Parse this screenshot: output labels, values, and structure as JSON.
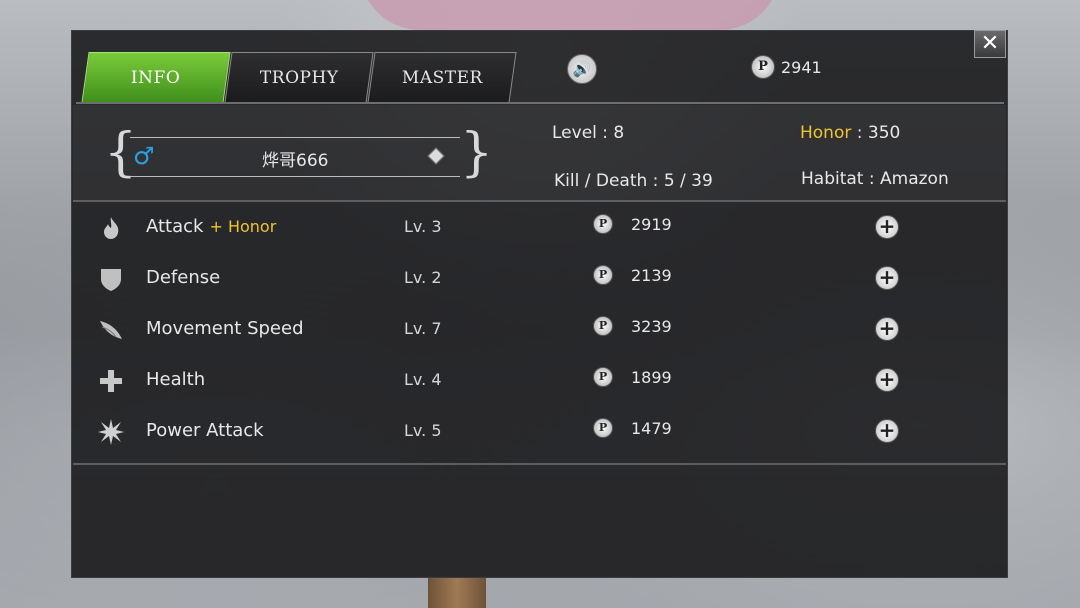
{
  "tabs": [
    {
      "label": "INFO",
      "active": true
    },
    {
      "label": "TROPHY",
      "active": false
    },
    {
      "label": "MASTER",
      "active": false
    }
  ],
  "currency": {
    "icon": "p-coin-icon",
    "amount": "2941"
  },
  "profile": {
    "name": "烨哥666",
    "gender_icon": "male-icon",
    "level_label": "Level",
    "level": "8",
    "honor_label": "Honor",
    "honor": "350",
    "kd_label": "Kill / Death",
    "kills": "5",
    "deaths": "39",
    "kd_text": "5 / 39",
    "habitat_label": "Habitat",
    "habitat": "Amazon"
  },
  "stats": [
    {
      "name": "Attack",
      "bonus": "+ Honor",
      "level": "Lv. 3",
      "cost": "2919",
      "icon": "flame-icon"
    },
    {
      "name": "Defense",
      "bonus": "",
      "level": "Lv. 2",
      "cost": "2139",
      "icon": "shield-icon"
    },
    {
      "name": "Movement Speed",
      "bonus": "",
      "level": "Lv. 7",
      "cost": "3239",
      "icon": "wing-icon"
    },
    {
      "name": "Health",
      "bonus": "",
      "level": "Lv. 4",
      "cost": "1899",
      "icon": "cross-icon"
    },
    {
      "name": "Power Attack",
      "bonus": "",
      "level": "Lv. 5",
      "cost": "1479",
      "icon": "burst-icon"
    }
  ],
  "colors": {
    "active_tab": "#5fb02b",
    "honor": "#f1c232",
    "male": "#2e9fe0"
  }
}
